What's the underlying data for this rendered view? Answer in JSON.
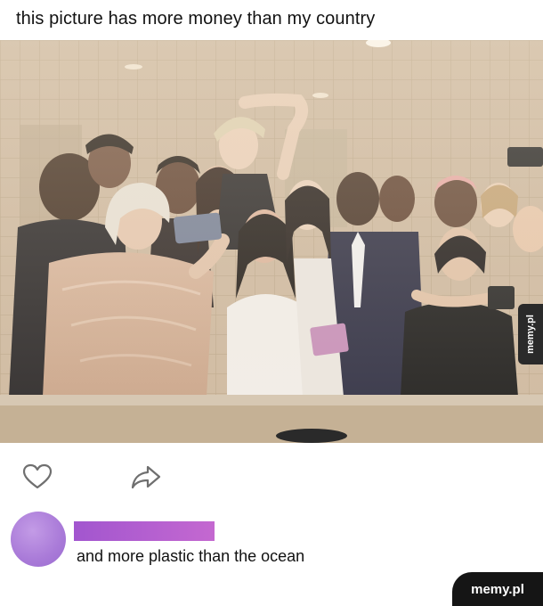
{
  "post": {
    "title": "this picture has more money than my country"
  },
  "photo": {
    "description_icon": "photo-image",
    "watermark": "memy.pl"
  },
  "actions": {
    "like_icon": "heart-outline-icon",
    "share_icon": "share-arrow-icon"
  },
  "comment": {
    "avatar_color": "#a97ad8",
    "username_bar_color": "#b25ccf",
    "text": "and more plastic than the ocean"
  },
  "brand": {
    "label": "memy.pl"
  }
}
